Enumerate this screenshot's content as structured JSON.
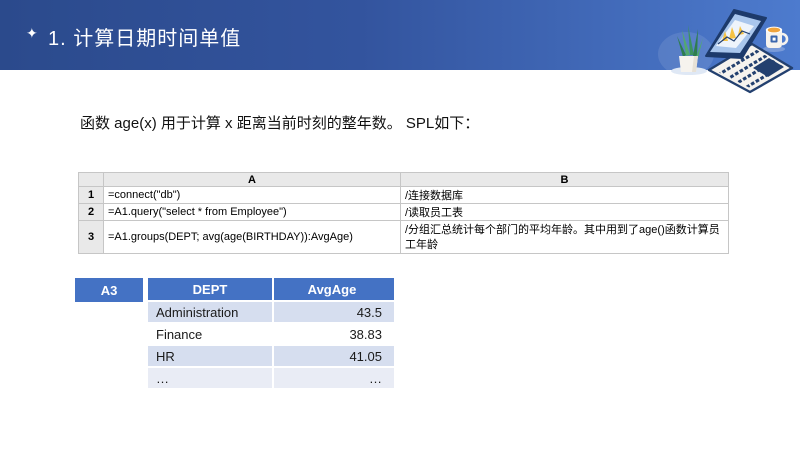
{
  "header": {
    "sparkle": "✦",
    "title": "1. 计算日期时间单值"
  },
  "intro_text": "函数 age(x) 用于计算 x 距离当前时刻的整年数。 SPL如下：",
  "spl_grid": {
    "corner": "",
    "columns": [
      "A",
      "B"
    ],
    "rows": [
      {
        "num": "1",
        "a": "=connect(\"db\")",
        "b": "/连接数据库"
      },
      {
        "num": "2",
        "a": "=A1.query(\"select * from Employee\")",
        "b": "/读取员工表"
      },
      {
        "num": "3",
        "a": "=A1.groups(DEPT; avg(age(BIRTHDAY)):AvgAge)",
        "b": "/分组汇总统计每个部门的平均年龄。其中用到了age()函数计算员工年龄"
      }
    ]
  },
  "result_table": {
    "cell_ref": "A3",
    "columns": [
      "DEPT",
      "AvgAge"
    ],
    "rows": [
      {
        "dept": "Administration",
        "avg_age": "43.5"
      },
      {
        "dept": "Finance",
        "avg_age": "38.83"
      },
      {
        "dept": "HR",
        "avg_age": "41.05"
      },
      {
        "dept": "…",
        "avg_age": "…"
      }
    ]
  },
  "colors": {
    "banner_gradient_start": "#2b4a8c",
    "banner_gradient_end": "#4d7bce",
    "table_header_blue": "#4472c4",
    "band_light_blue": "#d6deef",
    "band_lighter_blue": "#e9ecf5",
    "grid_header_gray": "#e9e9e9"
  }
}
